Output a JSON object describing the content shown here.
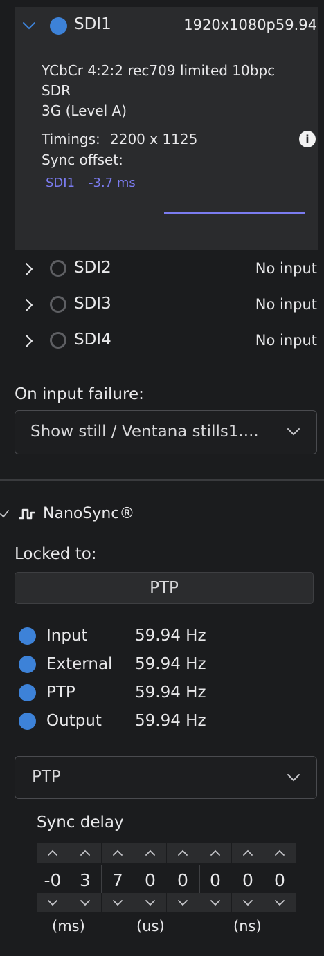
{
  "sdi1": {
    "name": "SDI1",
    "format": "1920x1080p59.94",
    "colorspace": "YCbCr 4:2:2 rec709 limited 10bpc",
    "range": "SDR",
    "link": "3G (Level A)",
    "timings_label": "Timings:",
    "timings_value": "2200 x 1125",
    "sync_offset_label": "Sync offset:",
    "offset_source": "SDI1",
    "offset_value": "-3.7 ms"
  },
  "inputs": [
    {
      "name": "SDI2",
      "status": "No input"
    },
    {
      "name": "SDI3",
      "status": "No input"
    },
    {
      "name": "SDI4",
      "status": "No input"
    }
  ],
  "failure": {
    "label": "On input failure:",
    "value": "Show still / Ventana stills1...."
  },
  "nanosync": {
    "title": "NanoSync®",
    "locked_label": "Locked to:",
    "locked_value": "PTP",
    "rates": [
      {
        "label": "Input",
        "value": "59.94 Hz"
      },
      {
        "label": "External",
        "value": "59.94 Hz"
      },
      {
        "label": "PTP",
        "value": "59.94 Hz"
      },
      {
        "label": "Output",
        "value": "59.94 Hz"
      }
    ],
    "source_select": "PTP"
  },
  "sync_delay": {
    "label": "Sync delay",
    "digits": [
      "-0",
      "3",
      "7",
      "0",
      "0",
      "0",
      "0",
      "0"
    ],
    "units": [
      "(ms)",
      "(us)",
      "(ns)"
    ]
  },
  "colors": {
    "accent": "#3d82d8",
    "offset_text": "#7b7cf0",
    "panel": "#2a2b2d",
    "background": "#1b1c1e"
  }
}
